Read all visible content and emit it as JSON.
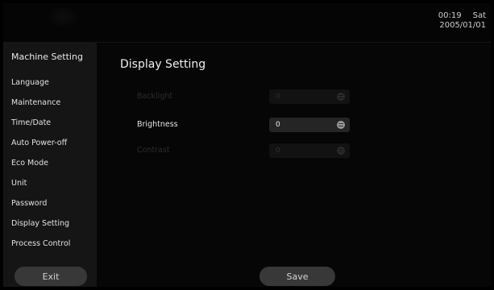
{
  "status": {
    "time": "00:19",
    "day": "Sat",
    "date": "2005/01/01"
  },
  "sidebar": {
    "title": "Machine Setting",
    "items": [
      {
        "label": "Language"
      },
      {
        "label": "Maintenance"
      },
      {
        "label": "Time/Date"
      },
      {
        "label": "Auto Power-off"
      },
      {
        "label": "Eco Mode"
      },
      {
        "label": "Unit"
      },
      {
        "label": "Password"
      },
      {
        "label": "Display Setting",
        "selected": true
      },
      {
        "label": "Process Control"
      }
    ],
    "exit_label": "Exit"
  },
  "main": {
    "title": "Display Setting",
    "settings": [
      {
        "label": "Backlight",
        "value": "0",
        "enabled": false
      },
      {
        "label": "Brightness",
        "value": "0",
        "enabled": true
      },
      {
        "label": "Contrast",
        "value": "0",
        "enabled": false
      }
    ],
    "save_label": "Save"
  },
  "icons": {
    "field_control": "spin-icon"
  },
  "colors": {
    "background": "#000000",
    "sidebar": "#151515",
    "button": "#383838",
    "field_enabled": "#252525",
    "field_disabled": "#121212",
    "text": "#e6e6e6"
  }
}
